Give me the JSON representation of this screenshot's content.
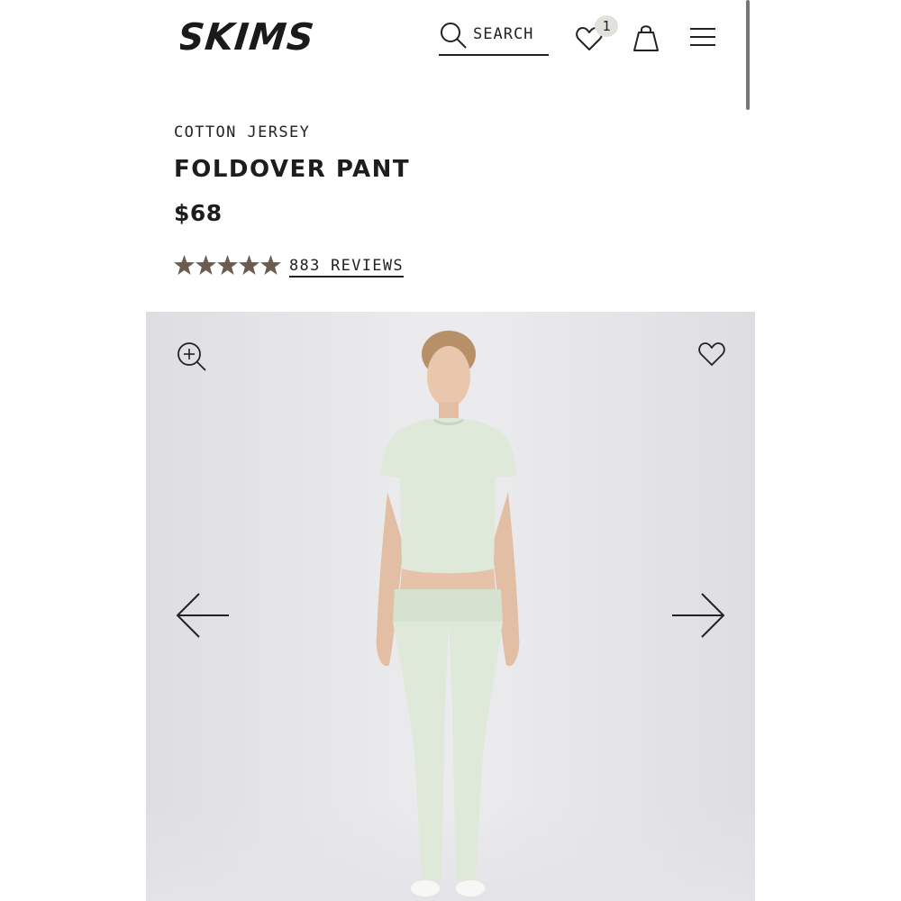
{
  "header": {
    "logo_text": "SKIMS",
    "search_label": "SEARCH",
    "wishlist_count": "1",
    "icons": [
      "search-icon",
      "heart-icon",
      "shopping-bag-icon",
      "hamburger-menu-icon"
    ]
  },
  "product": {
    "category": "COTTON JERSEY",
    "name": "FOLDOVER PANT",
    "price": "$68",
    "rating": 5,
    "reviews_label": "883 REVIEWS"
  },
  "gallery": {
    "icons": [
      "zoom-in-icon",
      "heart-icon",
      "arrow-left-icon",
      "arrow-right-icon"
    ],
    "image_subject": "model wearing mint top and foldover pant"
  },
  "colors": {
    "text": "#222222",
    "star": "#6b5d50",
    "badge": "#dfe3dc",
    "gallery_bg": "#ebebee",
    "garment": "#dfe9da"
  }
}
